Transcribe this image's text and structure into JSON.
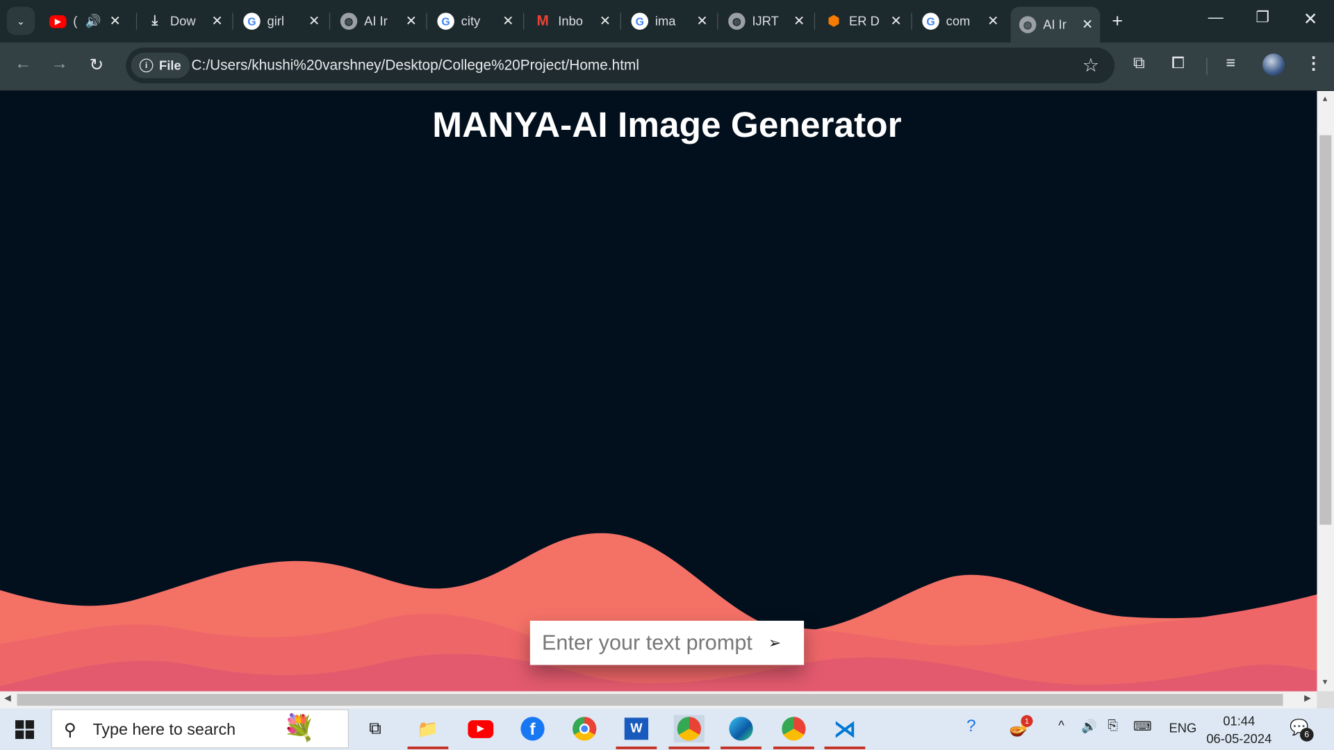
{
  "browser": {
    "tabs": [
      {
        "title": "(",
        "icon": "youtube-icon",
        "color": "#ff0000"
      },
      {
        "title": "Dow",
        "icon": "download-icon",
        "color": "#e8eaed"
      },
      {
        "title": "girl",
        "icon": "google-icon",
        "color": "#ffffff"
      },
      {
        "title": "AI Ir",
        "icon": "globe-icon",
        "color": "#9aa0a6"
      },
      {
        "title": "city",
        "icon": "google-icon",
        "color": "#ffffff"
      },
      {
        "title": "Inbo",
        "icon": "gmail-icon",
        "color": "#ea4335"
      },
      {
        "title": "ima",
        "icon": "google-icon",
        "color": "#ffffff"
      },
      {
        "title": "IJRT",
        "icon": "globe-icon",
        "color": "#9aa0a6"
      },
      {
        "title": "ER D",
        "icon": "orange-logo-icon",
        "color": "#f57c00"
      },
      {
        "title": "com",
        "icon": "google-icon",
        "color": "#ffffff"
      },
      {
        "title": "AI Ir",
        "icon": "globe-icon",
        "color": "#9aa0a6",
        "active": true
      }
    ],
    "file_label": "File",
    "url": "C:/Users/khushi%20varshney/Desktop/College%20Project/Home.html"
  },
  "page": {
    "title": "MANYA-AI Image Generator",
    "prompt_placeholder": "Enter your text prompt",
    "send_glyph": "➢",
    "colors": {
      "background": "#020f1d",
      "wave_front": "#f47166",
      "wave_back": "#e35a6e"
    }
  },
  "taskbar": {
    "search_placeholder": "Type here to search",
    "language": "ENG",
    "time": "01:44",
    "date": "06-05-2024",
    "notification_count": "6",
    "tray_badge": "1"
  }
}
